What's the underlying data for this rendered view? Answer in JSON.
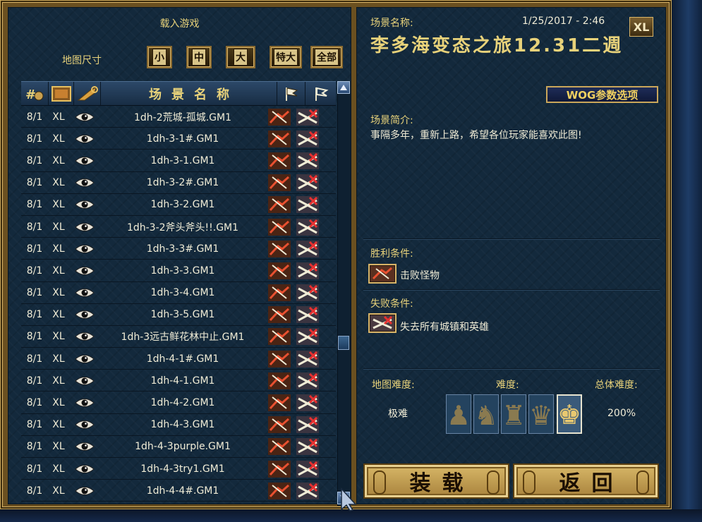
{
  "load_title": "载入游戏",
  "map_size": {
    "label": "地图尺寸",
    "buttons": [
      "小",
      "中",
      "大",
      "特大",
      "全部"
    ]
  },
  "list": {
    "header_title": "场景名称",
    "rows": [
      {
        "players": "8/1",
        "size": "XL",
        "name": "1dh-2荒城-孤城.GM1"
      },
      {
        "players": "8/1",
        "size": "XL",
        "name": "1dh-3-1#.GM1"
      },
      {
        "players": "8/1",
        "size": "XL",
        "name": "1dh-3-1.GM1"
      },
      {
        "players": "8/1",
        "size": "XL",
        "name": "1dh-3-2#.GM1"
      },
      {
        "players": "8/1",
        "size": "XL",
        "name": "1dh-3-2.GM1"
      },
      {
        "players": "8/1",
        "size": "XL",
        "name": "1dh-3-2斧头斧头!!.GM1"
      },
      {
        "players": "8/1",
        "size": "XL",
        "name": "1dh-3-3#.GM1"
      },
      {
        "players": "8/1",
        "size": "XL",
        "name": "1dh-3-3.GM1"
      },
      {
        "players": "8/1",
        "size": "XL",
        "name": "1dh-3-4.GM1"
      },
      {
        "players": "8/1",
        "size": "XL",
        "name": "1dh-3-5.GM1"
      },
      {
        "players": "8/1",
        "size": "XL",
        "name": "1dh-3远古鲜花林中止.GM1"
      },
      {
        "players": "8/1",
        "size": "XL",
        "name": "1dh-4-1#.GM1"
      },
      {
        "players": "8/1",
        "size": "XL",
        "name": "1dh-4-1.GM1"
      },
      {
        "players": "8/1",
        "size": "XL",
        "name": "1dh-4-2.GM1"
      },
      {
        "players": "8/1",
        "size": "XL",
        "name": "1dh-4-3.GM1"
      },
      {
        "players": "8/1",
        "size": "XL",
        "name": "1dh-4-3purple.GM1"
      },
      {
        "players": "8/1",
        "size": "XL",
        "name": "1dh-4-3try1.GM1"
      },
      {
        "players": "8/1",
        "size": "XL",
        "name": "1dh-4-4#.GM1"
      }
    ]
  },
  "details": {
    "scenario_name_label": "场景名称:",
    "date": "1/25/2017 - 2:46",
    "map_title": "李多海变态之旅12.31二週",
    "size_badge": "XL",
    "wog_button": "WOG参数选项",
    "description_label": "场景简介:",
    "description": "事隔多年，重新上路，希望各位玩家能喜欢此图!",
    "victory_label": "胜利条件:",
    "victory_text": "击败怪物",
    "loss_label": "失败条件:",
    "loss_text": "失去所有城镇和英雄",
    "map_difficulty_label": "地图难度:",
    "map_difficulty_value": "极难",
    "difficulty_label": "难度:",
    "overall_difficulty_label": "总体难度:",
    "overall_difficulty_value": "200%",
    "selected_difficulty_index": 4
  },
  "buttons": {
    "load": "装载",
    "back": "返回"
  }
}
